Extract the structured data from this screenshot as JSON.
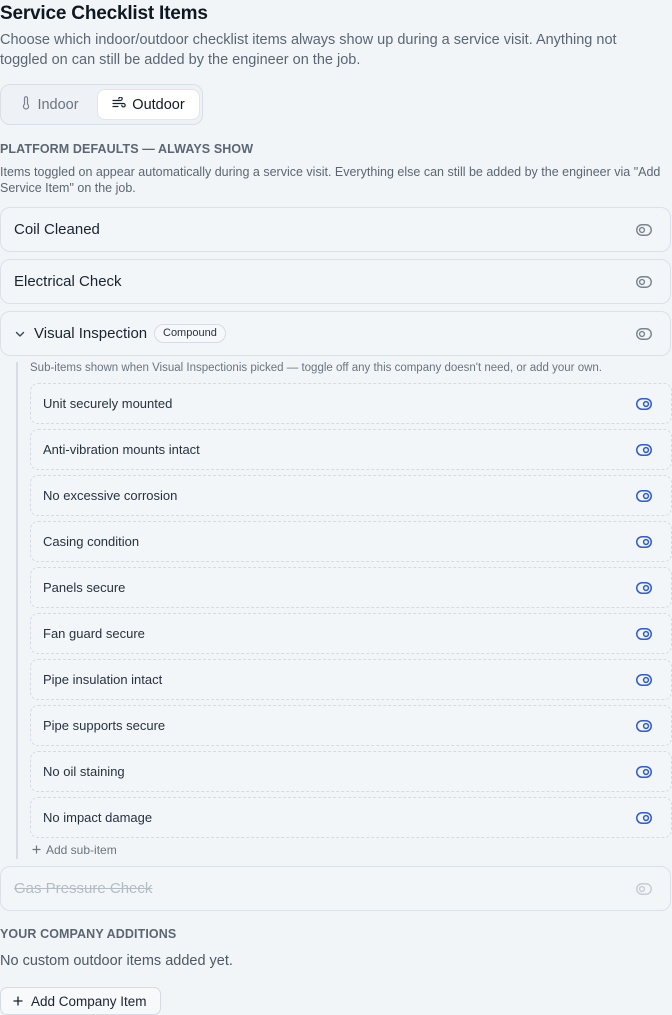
{
  "header": {
    "title": "Service Checklist Items",
    "subtitle": "Choose which indoor/outdoor checklist items always show up during a service visit. Anything not toggled on can still be added by the engineer on the job."
  },
  "tabs": {
    "indoor": "Indoor",
    "outdoor": "Outdoor",
    "active": "Outdoor"
  },
  "platform_defaults": {
    "title": "PLATFORM DEFAULTS — ALWAYS SHOW",
    "description": "Items toggled on appear automatically during a service visit. Everything else can still be added by the engineer via \"Add Service Item\" on the job.",
    "items": [
      {
        "label": "Coil Cleaned",
        "enabled": false
      },
      {
        "label": "Electrical Check",
        "enabled": false
      },
      {
        "label": "Visual Inspection",
        "badge": "Compound",
        "enabled": false,
        "expanded": true,
        "hint": "Sub-items shown when Visual Inspectionis picked — toggle off any this company doesn't need, or add your own.",
        "sub_items": [
          {
            "label": "Unit securely mounted",
            "enabled": true
          },
          {
            "label": "Anti-vibration mounts intact",
            "enabled": true
          },
          {
            "label": "No excessive corrosion",
            "enabled": true
          },
          {
            "label": "Casing condition",
            "enabled": true
          },
          {
            "label": "Panels secure",
            "enabled": true
          },
          {
            "label": "Fan guard secure",
            "enabled": true
          },
          {
            "label": "Pipe insulation intact",
            "enabled": true
          },
          {
            "label": "Pipe supports secure",
            "enabled": true
          },
          {
            "label": "No oil staining",
            "enabled": true
          },
          {
            "label": "No impact damage",
            "enabled": true
          }
        ],
        "add_sub_item": "Add sub-item"
      },
      {
        "label": "Gas Pressure Check",
        "enabled": false,
        "disabled": true
      }
    ]
  },
  "company_additions": {
    "title": "YOUR COMPANY ADDITIONS",
    "empty_text": "No custom outdoor items added yet.",
    "add_button": "Add Company Item"
  },
  "colors": {
    "accent": "#2f5bd3",
    "muted_toggle": "#7b848e",
    "disabled_toggle": "#c5ccd4"
  }
}
